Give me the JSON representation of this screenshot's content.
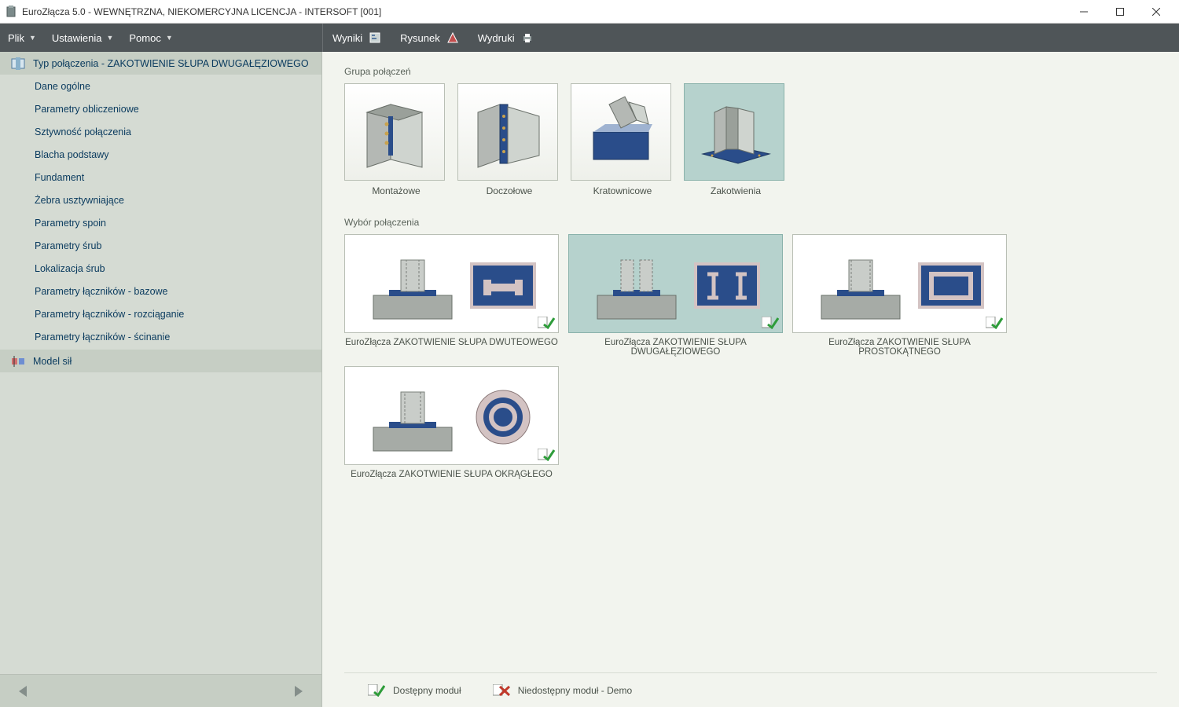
{
  "title": "EuroZłącza 5.0 - WEWNĘTRZNA, NIEKOMERCYJNA LICENCJA - INTERSOFT [001]",
  "menu": {
    "left": [
      "Plik",
      "Ustawienia",
      "Pomoc"
    ],
    "right": [
      "Wyniki",
      "Rysunek",
      "Wydruki"
    ]
  },
  "sidebar": {
    "header": "Typ połączenia - ZAKOTWIENIE SŁUPA DWUGAŁĘZIOWEGO",
    "items": [
      "Dane ogólne",
      "Parametry obliczeniowe",
      "Sztywność połączenia",
      "Blacha podstawy",
      "Fundament",
      "Żebra usztywniające",
      "Parametry spoin",
      "Parametry śrub",
      "Lokalizacja śrub",
      "Parametry łączników - bazowe",
      "Parametry łączników - rozciąganie",
      "Parametry łączników - ścinanie"
    ],
    "footer": "Model sił"
  },
  "main": {
    "group_label": "Grupa połączeń",
    "groups": [
      {
        "caption": "Montażowe"
      },
      {
        "caption": "Doczołowe"
      },
      {
        "caption": "Kratownicowe"
      },
      {
        "caption": "Zakotwienia"
      }
    ],
    "selection_label": "Wybór połączenia",
    "selections": [
      {
        "caption": "EuroZłącza ZAKOTWIENIE SŁUPA DWUTEOWEGO"
      },
      {
        "caption": "EuroZłącza ZAKOTWIENIE SŁUPA DWUGAŁĘZIOWEGO"
      },
      {
        "caption": "EuroZłącza ZAKOTWIENIE SŁUPA PROSTOKĄTNEGO"
      },
      {
        "caption": "EuroZłącza ZAKOTWIENIE SŁUPA OKRĄGŁEGO"
      }
    ]
  },
  "footer": {
    "available": "Dostępny moduł",
    "unavailable": "Niedostępny moduł - Demo"
  }
}
